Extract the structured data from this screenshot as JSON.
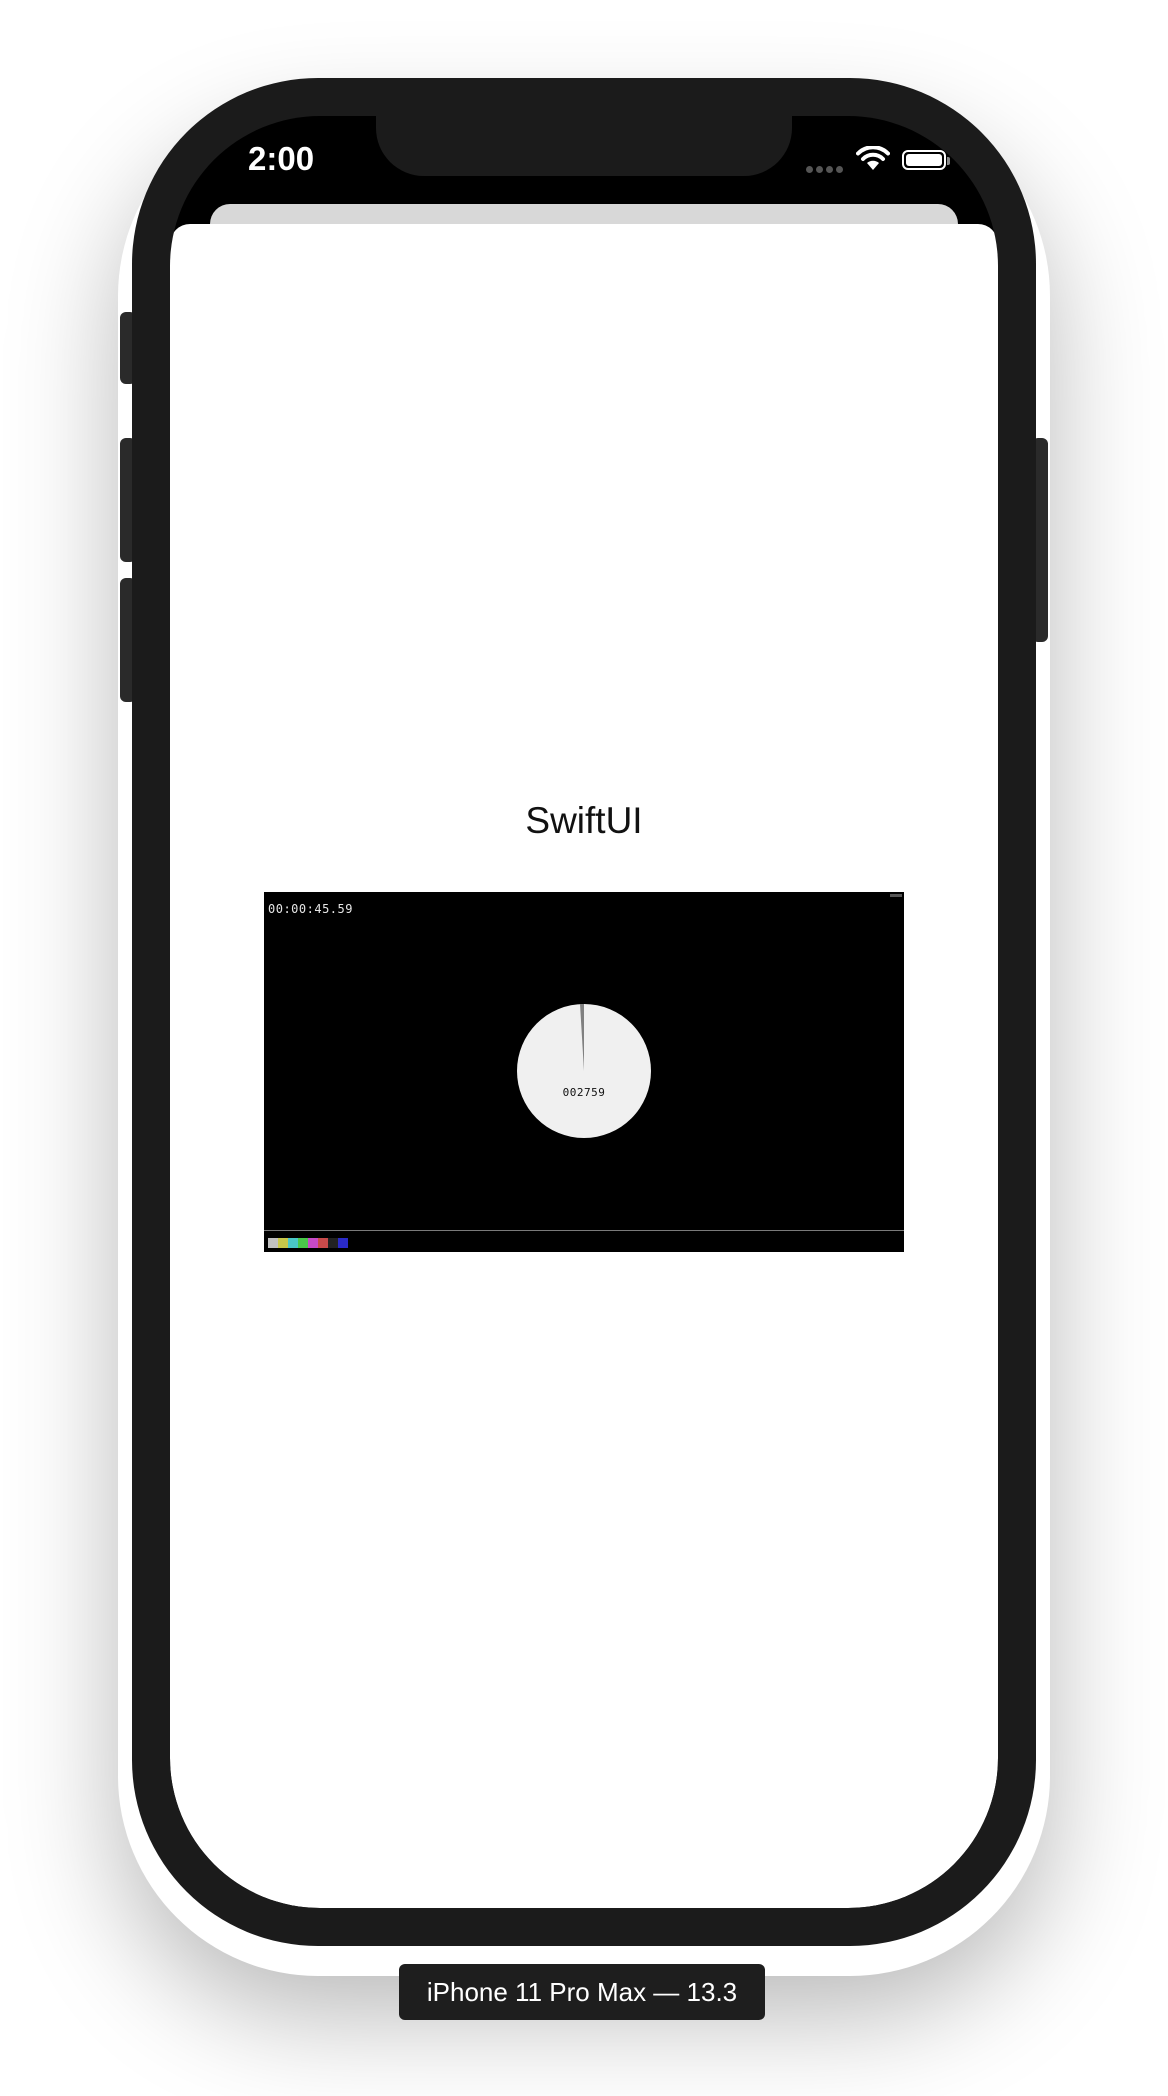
{
  "status_bar": {
    "time": "2:00"
  },
  "content": {
    "title": "SwiftUI"
  },
  "video": {
    "timecode": "00:00:45.59",
    "frame_count": "002759",
    "color_bars": [
      "#c0c0c0",
      "#c7c74a",
      "#4ac7c7",
      "#4ac74a",
      "#c74ac7",
      "#c74a4a",
      "#222222",
      "#2a2ac7"
    ]
  },
  "device": {
    "label": "iPhone 11 Pro Max — 13.3"
  }
}
